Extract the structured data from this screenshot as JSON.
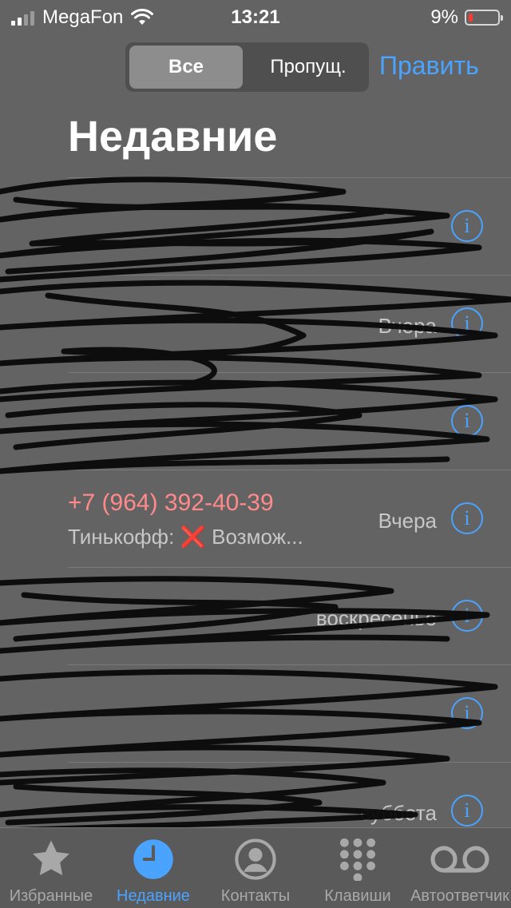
{
  "status": {
    "carrier": "MegaFon",
    "time": "13:21",
    "battery": "9%",
    "battery_level": 0.09,
    "battery_color": "#ff3b30"
  },
  "header": {
    "segment_all": "Все",
    "segment_missed": "Пропущ.",
    "edit": "Править",
    "title": "Недавние"
  },
  "calls": [
    {
      "name": "",
      "sub": "",
      "time": "",
      "missed": false
    },
    {
      "name": "",
      "sub": "",
      "time": "Вчера",
      "missed": false
    },
    {
      "name": "",
      "sub": "",
      "time": "",
      "missed": false
    },
    {
      "name": "+7 (964) 392-40-39",
      "sub_prefix": "Тинькофф:",
      "sub_icon": "❌",
      "sub_text": "Возмож...",
      "time": "Вчера",
      "missed": true
    },
    {
      "name": "",
      "sub": "",
      "time": "воскресенье",
      "missed": false
    },
    {
      "name": "",
      "sub": "",
      "time": "",
      "missed": false
    },
    {
      "name": "",
      "sub": "",
      "time": "суббота",
      "missed": false
    }
  ],
  "tabs": [
    {
      "label": "Избранные",
      "icon": "star-icon"
    },
    {
      "label": "Недавние",
      "icon": "clock-icon"
    },
    {
      "label": "Контакты",
      "icon": "person-circle-icon"
    },
    {
      "label": "Клавиши",
      "icon": "keypad-icon"
    },
    {
      "label": "Автоответчик",
      "icon": "voicemail-icon"
    }
  ],
  "colors": {
    "accent": "#4aa3ff",
    "missed": "#ff8a8a",
    "background": "#636363"
  }
}
